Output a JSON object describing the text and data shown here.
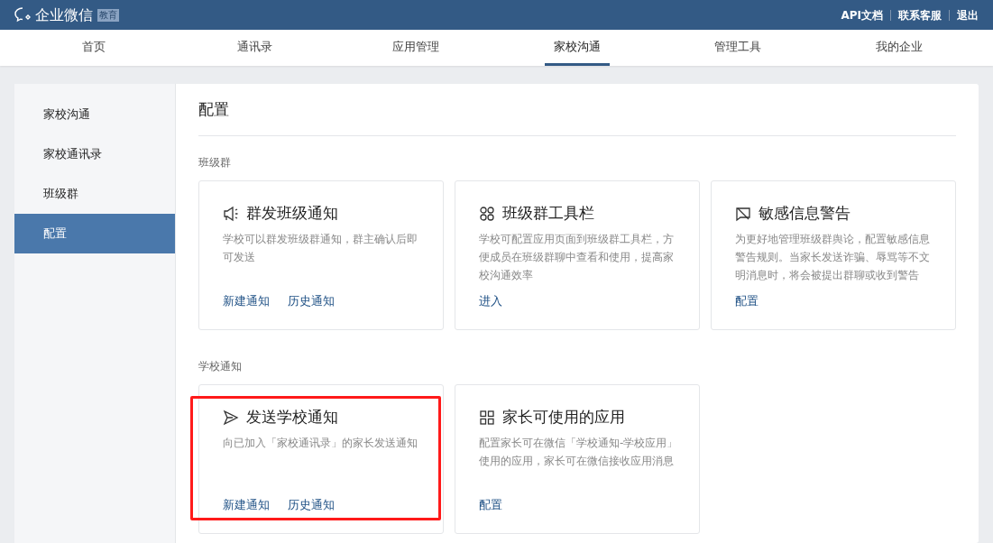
{
  "header": {
    "logo_text": "企业微信",
    "logo_badge": "教育",
    "links": [
      "API文档",
      "联系客服",
      "退出"
    ]
  },
  "nav_tabs": [
    {
      "label": "首页",
      "selected": false
    },
    {
      "label": "通讯录",
      "selected": false
    },
    {
      "label": "应用管理",
      "selected": false
    },
    {
      "label": "家校沟通",
      "selected": true
    },
    {
      "label": "管理工具",
      "selected": false
    },
    {
      "label": "我的企业",
      "selected": false
    }
  ],
  "sidebar": {
    "items": [
      {
        "label": "家校沟通",
        "selected": false
      },
      {
        "label": "家校通讯录",
        "selected": false
      },
      {
        "label": "班级群",
        "selected": false
      },
      {
        "label": "配置",
        "selected": true
      }
    ]
  },
  "page_title": "配置",
  "sections": [
    {
      "title": "班级群",
      "cards": [
        {
          "kind": "megaphone",
          "title": "群发班级通知",
          "description": "学校可以群发班级群通知，群主确认后即可发送",
          "links": [
            "新建通知",
            "历史通知"
          ],
          "highlighted": false
        },
        {
          "kind": "clover",
          "title": "班级群工具栏",
          "description": "学校可配置应用页面到班级群工具栏，方便成员在班级群聊中查看和使用，提高家校沟通效率",
          "links": [
            "进入"
          ],
          "highlighted": false
        },
        {
          "kind": "warning",
          "title": "敏感信息警告",
          "description": "为更好地管理班级群舆论，配置敏感信息警告规则。当家长发送诈骗、辱骂等不文明消息时，将会被提出群聊或收到警告",
          "links": [
            "配置"
          ],
          "highlighted": false
        }
      ]
    },
    {
      "title": "学校通知",
      "cards": [
        {
          "kind": "send",
          "title": "发送学校通知",
          "description": "向已加入「家校通讯录」的家长发送通知",
          "links": [
            "新建通知",
            "历史通知"
          ],
          "highlighted": true
        },
        {
          "kind": "grid",
          "title": "家长可使用的应用",
          "description": "配置家长可在微信「学校通知-学校应用」使用的应用，家长可在微信接收应用消息",
          "links": [
            "配置"
          ],
          "highlighted": false
        }
      ]
    }
  ]
}
